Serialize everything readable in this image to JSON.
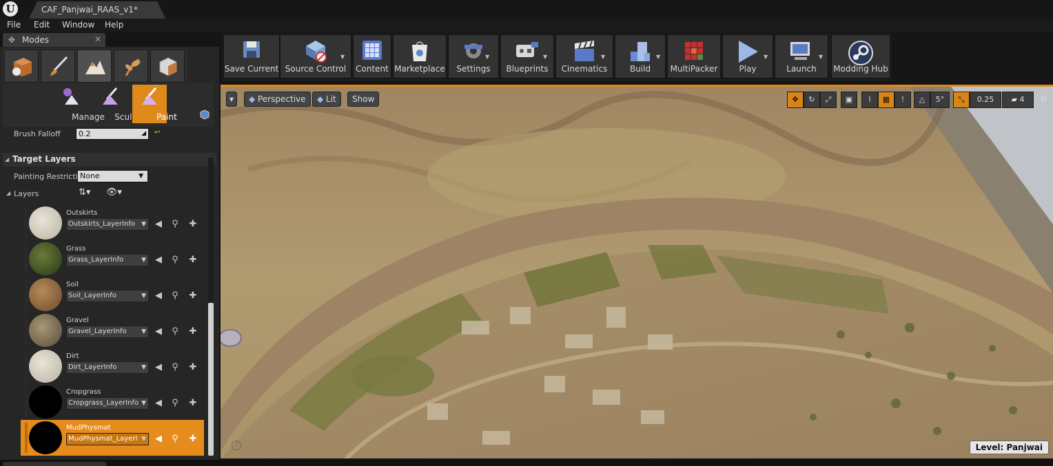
{
  "window": {
    "doc_tab": "CAF_Panjwai_RAAS_v1*",
    "logo": "U"
  },
  "menu": [
    "File",
    "Edit",
    "Window",
    "Help"
  ],
  "modes_panel": {
    "tab_label": "Modes",
    "mode_icons": [
      "place-mode-icon",
      "paint-mode-icon",
      "landscape-mode-icon",
      "foliage-mode-icon",
      "geometry-mode-icon"
    ],
    "sub_tools": [
      "Manage",
      "Sculpt",
      "Paint"
    ],
    "brush_falloff_label": "Brush Falloff",
    "brush_falloff_value": "0.2",
    "target_layers_header": "Target Layers",
    "painting_restriction_label": "Painting Restricti",
    "painting_restriction_value": "None",
    "layers_label": "Layers",
    "layers": [
      {
        "name": "Outskirts",
        "info": "Outskirts_LayerInfo"
      },
      {
        "name": "Grass",
        "info": "Grass_LayerInfo"
      },
      {
        "name": "Soil",
        "info": "Soil_LayerInfo"
      },
      {
        "name": "Gravel",
        "info": "Gravel_LayerInfo"
      },
      {
        "name": "Dirt",
        "info": "Dirt_LayerInfo"
      },
      {
        "name": "Cropgrass",
        "info": "Cropgrass_LayerInfo"
      },
      {
        "name": "MudPhysmat",
        "info": "MudPhysmat_LayerI"
      }
    ]
  },
  "toolbar": [
    {
      "label": "Save Current",
      "icon": "save-icon"
    },
    {
      "label": "Source Control",
      "icon": "source-control-icon"
    },
    {
      "label": "Content",
      "icon": "content-icon"
    },
    {
      "label": "Marketplace",
      "icon": "marketplace-icon"
    },
    {
      "label": "Settings",
      "icon": "settings-icon"
    },
    {
      "label": "Blueprints",
      "icon": "blueprints-icon"
    },
    {
      "label": "Cinematics",
      "icon": "cinematics-icon"
    },
    {
      "label": "Build",
      "icon": "build-icon"
    },
    {
      "label": "MultiPacker",
      "icon": "multipacker-icon"
    },
    {
      "label": "Play",
      "icon": "play-icon"
    },
    {
      "label": "Launch",
      "icon": "launch-icon"
    },
    {
      "label": "Modding Hub",
      "icon": "steam-icon"
    }
  ],
  "viewport": {
    "view_mode": "Perspective",
    "lighting": "Lit",
    "show": "Show",
    "grid_angle": "5°",
    "scale_snap": "0.25",
    "camera_speed": "4",
    "level_label": "Level:  Panjwai"
  },
  "colors": {
    "accent": "#e08a1c",
    "panel": "#262626",
    "toolbar": "#333333"
  }
}
